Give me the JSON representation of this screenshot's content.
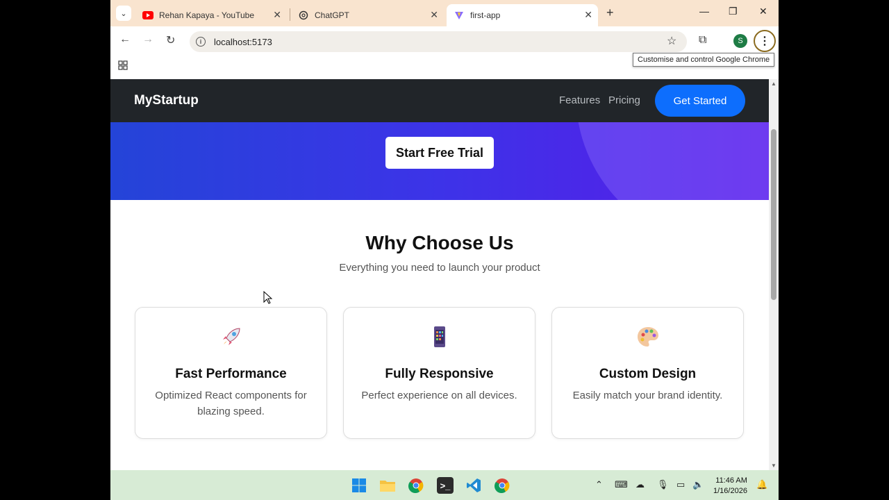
{
  "browser": {
    "tabs": [
      {
        "title": "Rehan Kapaya - YouTube",
        "active": false
      },
      {
        "title": "ChatGPT",
        "active": false
      },
      {
        "title": "first-app",
        "active": true
      }
    ],
    "url": "localhost:5173",
    "profile_initial": "S",
    "tooltip": "Customise and control Google Chrome"
  },
  "site": {
    "brand": "MyStartup",
    "nav": {
      "features": "Features",
      "pricing": "Pricing",
      "cta": "Get Started"
    },
    "hero": {
      "trial_button": "Start Free Trial"
    },
    "section": {
      "title": "Why Choose Us",
      "subtitle": "Everything you need to launch your product"
    },
    "cards": [
      {
        "icon": "rocket-icon",
        "title": "Fast Performance",
        "desc": "Optimized React components for blazing speed."
      },
      {
        "icon": "mobile-icon",
        "title": "Fully Responsive",
        "desc": "Perfect experience on all devices."
      },
      {
        "icon": "palette-icon",
        "title": "Custom Design",
        "desc": "Easily match your brand identity."
      }
    ]
  },
  "taskbar": {
    "time": "11:46 AM",
    "date": "1/16/2026"
  },
  "colors": {
    "navbar": "#212529",
    "accent": "#0d6efd",
    "hero_start": "#2444d8",
    "hero_end": "#5a1be8"
  }
}
